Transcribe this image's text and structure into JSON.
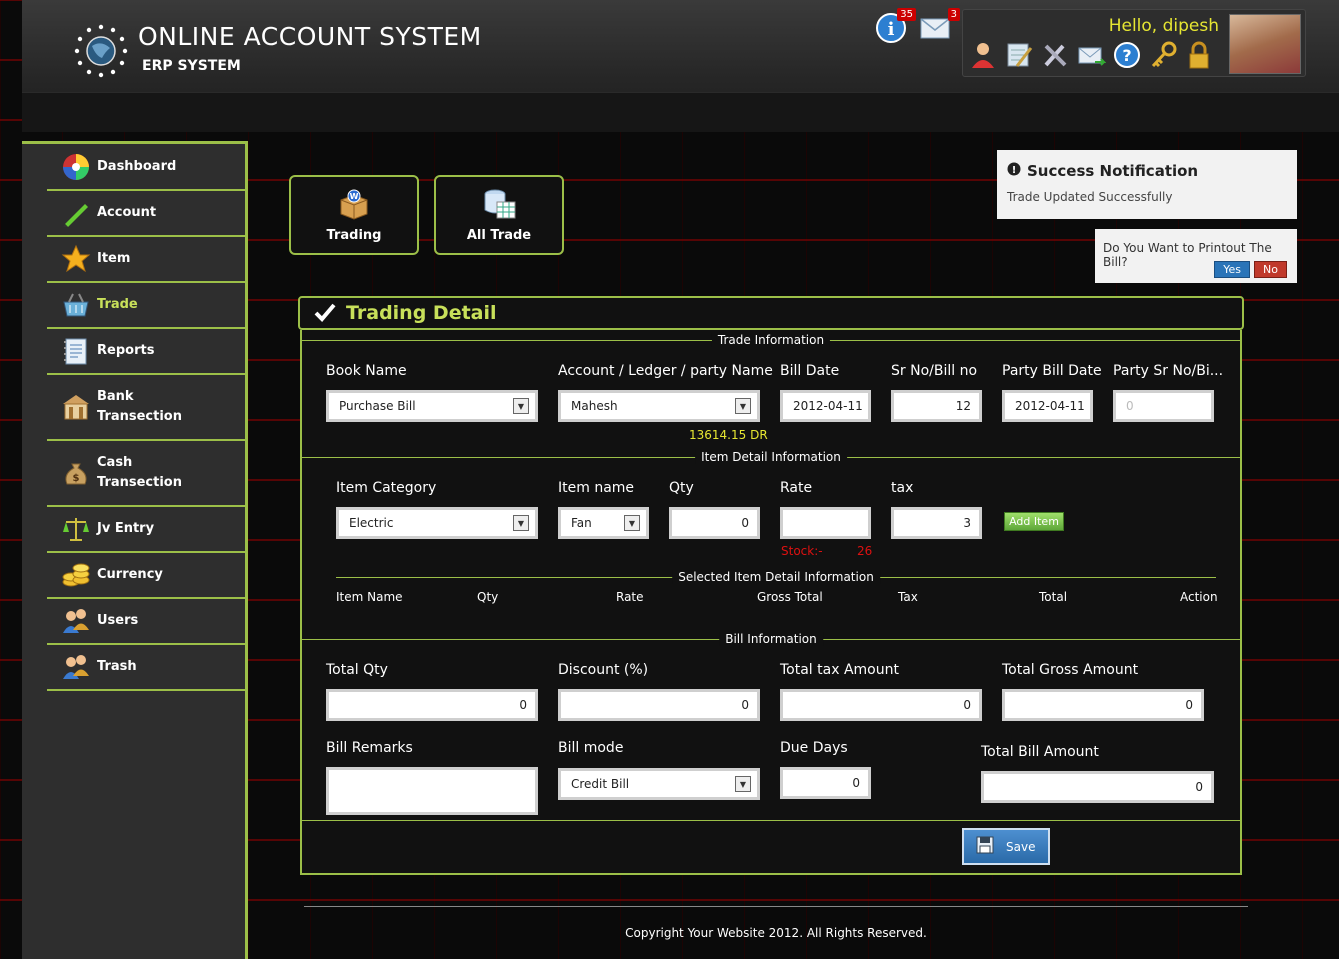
{
  "header": {
    "title": "ONLINE ACCOUNT SYSTEM",
    "subtitle": "ERP SYSTEM",
    "info_count": "35",
    "mail_count": "3",
    "greeting": "Hello, dipesh"
  },
  "sidebar": {
    "items": [
      {
        "label": "Dashboard",
        "icon": "color-wheel-icon"
      },
      {
        "label": "Account",
        "icon": "pencil-icon"
      },
      {
        "label": "Item",
        "icon": "star-icon"
      },
      {
        "label": "Trade",
        "icon": "basket-icon"
      },
      {
        "label": "Reports",
        "icon": "notebook-icon"
      },
      {
        "label": "Bank",
        "label2": "Transection",
        "icon": "bank-icon"
      },
      {
        "label": "Cash",
        "label2": "Transection",
        "icon": "money-bag-icon"
      },
      {
        "label": "Jv Entry",
        "icon": "scales-icon"
      },
      {
        "label": "Currency",
        "icon": "coins-icon"
      },
      {
        "label": "Users",
        "icon": "users-icon"
      },
      {
        "label": "Trash",
        "icon": "trash-users-icon"
      }
    ]
  },
  "quick": {
    "trading": "Trading",
    "all_trade": "All Trade"
  },
  "notification": {
    "title": "Success Notification",
    "message": "Trade Updated Successfully",
    "confirm_question": "Do You Want to Printout The Bill?",
    "yes": "Yes",
    "no": "No"
  },
  "panel": {
    "title": "Trading Detail",
    "trade_info_legend": "Trade Information",
    "item_info_legend": "Item Detail Information",
    "selected_legend": "Selected Item Detail Information",
    "bill_info_legend": "Bill Information"
  },
  "trade": {
    "book_name_label": "Book Name",
    "book_name_value": "Purchase Bill",
    "account_label": "Account / Ledger / party Name",
    "account_value": "Mahesh",
    "account_balance": "13614.15 DR",
    "bill_date_label": "Bill Date",
    "bill_date_value": "2012-04-11",
    "sr_no_label": "Sr No/Bill no",
    "sr_no_value": "12",
    "party_bill_date_label": "Party Bill Date",
    "party_bill_date_value": "2012-04-11",
    "party_sr_label": "Party Sr No/Bi...",
    "party_sr_value": "0"
  },
  "item": {
    "category_label": "Item Category",
    "category_value": "Electric",
    "name_label": "Item name",
    "name_value": "Fan",
    "qty_label": "Qty",
    "qty_value": "0",
    "rate_label": "Rate",
    "rate_value": "",
    "tax_label": "tax",
    "tax_value": "3",
    "stock_label": "Stock:-",
    "stock_value": "26",
    "add_button": "Add Item"
  },
  "selected_columns": [
    "Item Name",
    "Qty",
    "Rate",
    "Gross Total",
    "Tax",
    "Total",
    "Action"
  ],
  "bill": {
    "total_qty_label": "Total Qty",
    "total_qty_value": "0",
    "discount_label": "Discount (%)",
    "discount_value": "0",
    "total_tax_label": "Total tax Amount",
    "total_tax_value": "0",
    "total_gross_label": "Total Gross Amount",
    "total_gross_value": "0",
    "remarks_label": "Bill Remarks",
    "remarks_value": "",
    "mode_label": "Bill mode",
    "mode_value": "Credit Bill",
    "due_days_label": "Due Days",
    "due_days_value": "0",
    "total_bill_label": "Total Bill Amount",
    "total_bill_value": "0"
  },
  "actions": {
    "save": "Save"
  },
  "footer": {
    "copyright": "Copyright Your Website 2012. All Rights Reserved."
  },
  "colors": {
    "accent": "#9cbf48",
    "title_yellow": "#c8e05a",
    "hello_yellow": "#e6e632",
    "stock_red": "#d11"
  }
}
